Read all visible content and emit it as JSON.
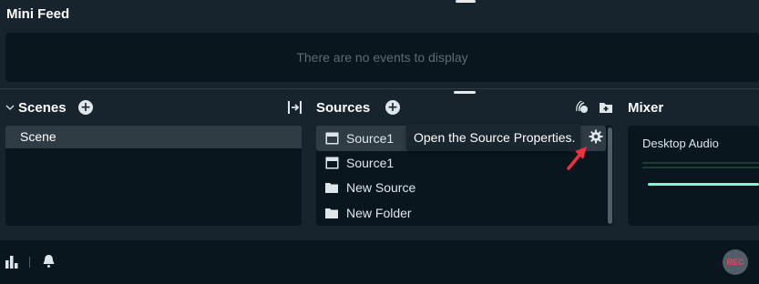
{
  "mini_feed": {
    "title": "Mini Feed",
    "empty_message": "There are no events to display"
  },
  "scenes": {
    "title": "Scenes",
    "items": [
      {
        "label": "Scene",
        "selected": true
      }
    ]
  },
  "sources": {
    "title": "Sources",
    "items": [
      {
        "label": "Source1",
        "icon": "window-icon",
        "selected": true
      },
      {
        "label": "Source1",
        "icon": "window-icon",
        "selected": false
      },
      {
        "label": "New Source",
        "icon": "folder-icon",
        "selected": false
      },
      {
        "label": "New Folder",
        "icon": "folder-icon",
        "selected": false
      }
    ],
    "tooltip": "Open the Source Properties."
  },
  "mixer": {
    "title": "Mixer",
    "channels": [
      {
        "label": "Desktop Audio"
      }
    ]
  },
  "bottom_bar": {
    "rec_label": "REC"
  },
  "colors": {
    "background": "#17242d",
    "panel": "#09161d",
    "selected_row": "#2f3c44",
    "accent_teal": "#80f5d2",
    "rec_red": "#fc3c5b",
    "annotation_arrow": "#f0313d"
  }
}
